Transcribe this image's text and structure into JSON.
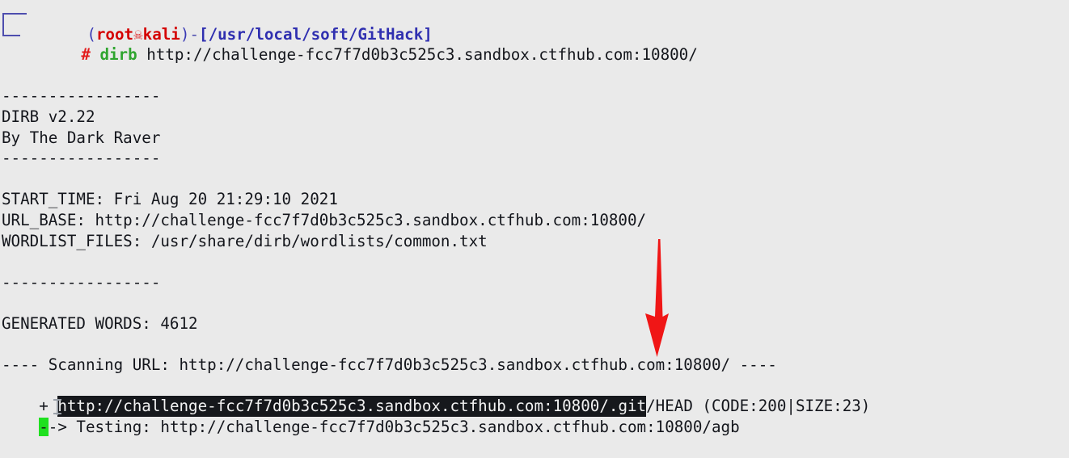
{
  "terminal": {
    "window_background": "#eaeaea",
    "foreground": "#14161c",
    "prompt": {
      "open_paren": "(",
      "user": "root",
      "skull_icon": "☠",
      "host": "kali",
      "close_paren": ")",
      "dash": "-",
      "path_open": "[",
      "path": "/usr/local/soft/GitHack",
      "path_close": "]",
      "hash": "#",
      "command_name": "dirb",
      "command_args": "http://challenge-fcc7f7d0b3c525c3.sandbox.ctfhub.com:10800/",
      "colors": {
        "user": "#d40000",
        "host": "#d40000",
        "path": "#2f2fb0",
        "hash": "#e31b1b",
        "command": "#2fa52f",
        "bracket": "#4d4dae"
      }
    },
    "lines": [
      {
        "type": "separator",
        "text": "-----------------"
      },
      {
        "type": "text",
        "text": "DIRB v2.22"
      },
      {
        "type": "text",
        "text": "By The Dark Raver"
      },
      {
        "type": "separator",
        "text": "-----------------"
      },
      {
        "type": "blank",
        "text": ""
      },
      {
        "type": "text",
        "text": "START_TIME: Fri Aug 20 21:29:10 2021"
      },
      {
        "type": "text",
        "text": "URL_BASE: http://challenge-fcc7f7d0b3c525c3.sandbox.ctfhub.com:10800/"
      },
      {
        "type": "text",
        "text": "WORDLIST_FILES: /usr/share/dirb/wordlists/common.txt"
      },
      {
        "type": "blank",
        "text": ""
      },
      {
        "type": "separator",
        "text": "-----------------"
      },
      {
        "type": "blank",
        "text": ""
      },
      {
        "type": "text",
        "text": "GENERATED WORDS: 4612"
      },
      {
        "type": "blank",
        "text": ""
      },
      {
        "type": "text",
        "text": "---- Scanning URL: http://challenge-fcc7f7d0b3c525c3.sandbox.ctfhub.com:10800/ ----"
      }
    ],
    "found_line": {
      "marker": "+ ",
      "selected_url": "http://challenge-fcc7f7d0b3c525c3.sandbox.ctfhub.com:10800/.git",
      "suffix": "/HEAD (CODE:200|SIZE:23)",
      "selection_background": "#16181c",
      "selection_foreground": "#f2f2f2"
    },
    "testing_line": {
      "cursor_char": "-",
      "cursor_color": "#1fe01f",
      "text": "-> Testing: http://challenge-fcc7f7d0b3c525c3.sandbox.ctfhub.com:10800/agb"
    },
    "annotation": {
      "type": "arrow",
      "color": "#f01616",
      "direction": "down",
      "points_at": ".git path in the discovered URL"
    }
  }
}
